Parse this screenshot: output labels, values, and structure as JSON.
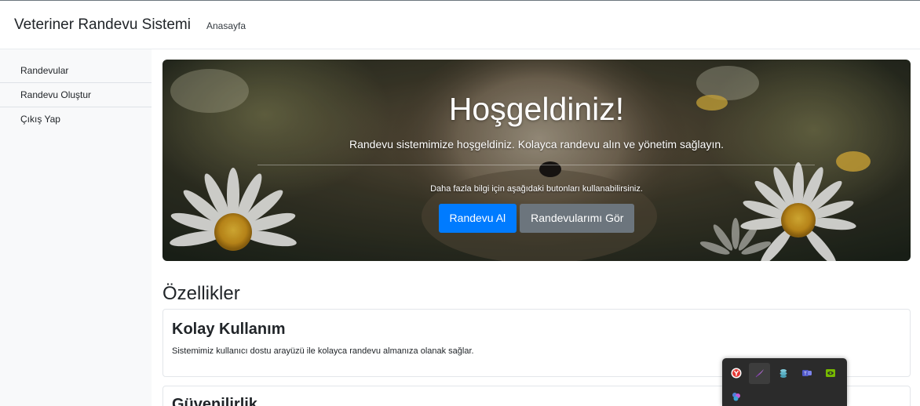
{
  "navbar": {
    "brand": "Veteriner Randevu Sistemi",
    "home_link": "Anasayfa"
  },
  "sidebar": {
    "items": [
      {
        "label": "Randevular"
      },
      {
        "label": "Randevu Oluştur"
      },
      {
        "label": "Çıkış Yap"
      }
    ]
  },
  "hero": {
    "title": "Hoşgeldiniz!",
    "lead": "Randevu sistemimize hoşgeldiniz. Kolayca randevu alın ve yönetim sağlayın.",
    "small": "Daha fazla bilgi için aşağıdaki butonları kullanabilirsiniz.",
    "primary_button": "Randevu Al",
    "secondary_button": "Randevularımı Gör"
  },
  "features": {
    "title": "Özellikler",
    "cards": [
      {
        "title": "Kolay Kullanım",
        "text": "Sistemimiz kullanıcı dostu arayüzü ile kolayca randevu almanıza olanak sağlar."
      },
      {
        "title": "Güvenilirlik",
        "text": ""
      }
    ]
  },
  "tray": {
    "icons": [
      "yandex-browser-icon",
      "feather-app-icon",
      "cloud-app-icon",
      "teams-app-icon",
      "nvidia-icon",
      "multi-app-icon"
    ]
  },
  "colors": {
    "primary": "#007bff",
    "secondary": "#6c757d"
  }
}
